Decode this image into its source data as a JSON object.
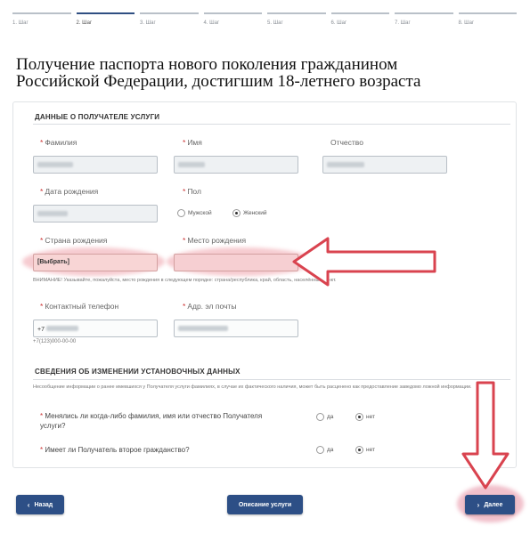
{
  "steps": [
    "1. Шаг",
    "2. Шаг",
    "3. Шаг",
    "4. Шаг",
    "5. Шаг",
    "6. Шаг",
    "7. Шаг",
    "8. Шаг"
  ],
  "active_step": 1,
  "title_line1": "Получение паспорта нового поколения гражданином",
  "title_line2": "Российской Федерации, достигшим 18-летнего возраста",
  "sections": {
    "recipient": "ДАННЫЕ О ПОЛУЧАТЕЛЕ УСЛУГИ",
    "changes": "СВЕДЕНИЯ ОБ ИЗМЕНЕНИИ УСТАНОВОЧНЫХ ДАННЫХ"
  },
  "fields": {
    "surname": "Фамилия",
    "name": "Имя",
    "patronymic": "Отчество",
    "birthdate": "Дата рождения",
    "sex": "Пол",
    "sex_male": "Мужской",
    "sex_female": "Женский",
    "birth_country": "Страна рождения",
    "birth_country_value": "[Выбрать]",
    "birth_place": "Место рождения",
    "birth_place_hint": "ВНИМАНИЕ! Указывайте, пожалуйста, место рождения в следующем порядке: страна/республика, край, область, населённый пункт.",
    "phone": "Контактный телефон",
    "phone_prefix": "+7",
    "phone_hint": "+7(123)000-00-00",
    "email": "Адр. эл почты"
  },
  "changes_notice": "Несообщение информации о ранее имевшихся у Получателя услуги фамилиях, в случае их фактического наличия, может быть расценено как предоставление заведомо ложной информации.",
  "questions": [
    {
      "text_line1": "Менялись ли когда-либо фамилия, имя или отчество Получателя",
      "text_line2": "услуги?",
      "yes": "да",
      "no": "нет"
    },
    {
      "text_line1": "Имеет ли Получатель второе гражданство?",
      "text_line2": "",
      "yes": "да",
      "no": "нет"
    }
  ],
  "buttons": {
    "back": "Назад",
    "description": "Описание услуги",
    "next": "Далее"
  },
  "colors": {
    "accent": "#2d4f86",
    "highlight": "#e8a0aa",
    "arrow": "#d9434f"
  }
}
